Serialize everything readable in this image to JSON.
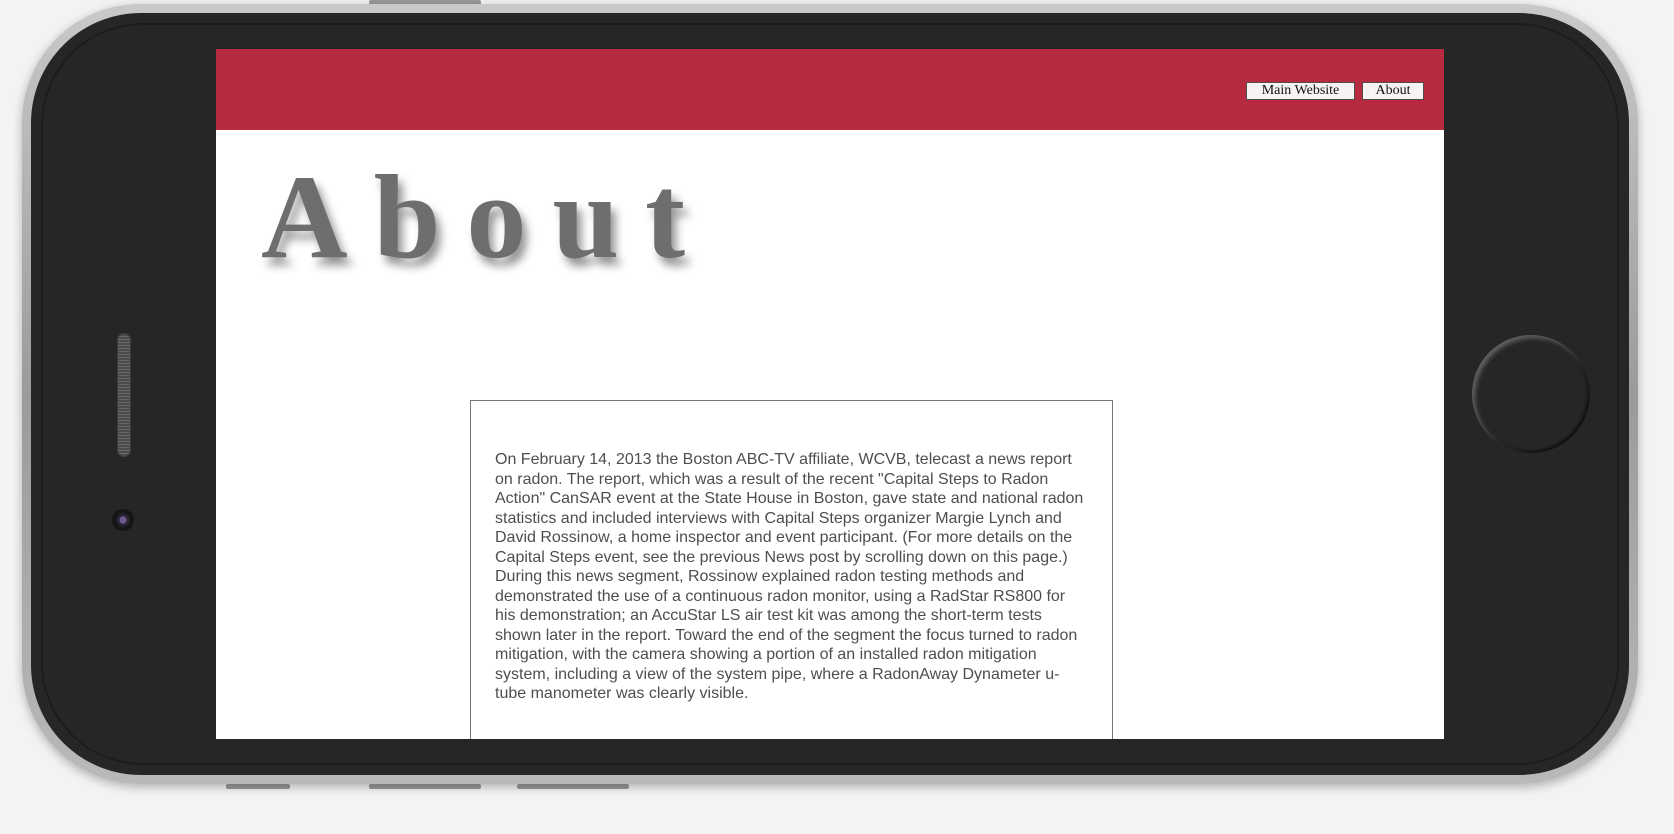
{
  "nav": {
    "main_website_label": "Main Website",
    "about_label": "About"
  },
  "page": {
    "title": "About",
    "article": "On February 14, 2013 the Boston ABC-TV affiliate, WCVB, telecast a news report on radon. The report, which was a result of the recent \"Capital Steps to Radon Action\" CanSAR event at the State House in Boston, gave state and national radon statistics and included interviews with Capital Steps organizer Margie Lynch and David Rossinow, a home inspector and event participant. (For more details on the Capital Steps event, see the previous News post by scrolling down on this page.) During this news segment, Rossinow explained radon testing methods and demonstrated the use of a continuous radon monitor, using a RadStar RS800 for his demonstration; an AccuStar LS air test kit was among the short-term tests shown later in the report. Toward the end of the segment the focus turned to radon mitigation, with the camera showing a portion of an installed radon mitigation system, including a view of the system pipe, where a RadonAway Dynameter u-tube manometer was clearly visible."
  },
  "colors": {
    "header_bar": "#b72a40",
    "title_text": "#6e6e6e",
    "body_text": "#4e4e4e",
    "device_body": "#262626"
  },
  "icons": {
    "speaker": "speaker-grille-icon",
    "camera": "front-camera-icon",
    "home": "home-button-icon"
  }
}
